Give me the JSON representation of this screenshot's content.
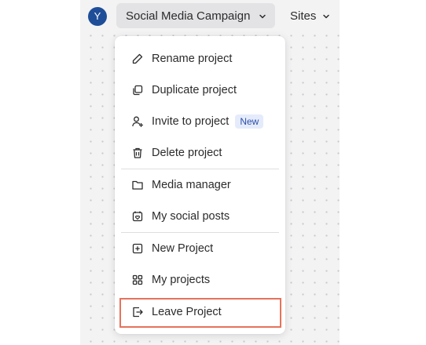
{
  "header": {
    "avatar_letter": "Y",
    "project_name": "Social Media Campaign",
    "sites_label": "Sites"
  },
  "menu": {
    "items": [
      {
        "label": "Rename project",
        "icon": "pencil-icon"
      },
      {
        "label": "Duplicate project",
        "icon": "duplicate-icon"
      },
      {
        "label": "Invite to project",
        "icon": "add-user-icon",
        "badge": "New"
      },
      {
        "label": "Delete project",
        "icon": "trash-icon"
      },
      {
        "label": "Media manager",
        "icon": "folder-icon"
      },
      {
        "label": "My social posts",
        "icon": "social-posts-icon"
      },
      {
        "label": "New Project",
        "icon": "plus-square-icon"
      },
      {
        "label": "My projects",
        "icon": "grid-icon"
      },
      {
        "label": "Leave Project",
        "icon": "exit-icon"
      }
    ]
  },
  "colors": {
    "highlight": "#e6735c",
    "avatar": "#1f4e99",
    "badge_bg": "#e4ebfb",
    "badge_text": "#2f4fa8"
  }
}
